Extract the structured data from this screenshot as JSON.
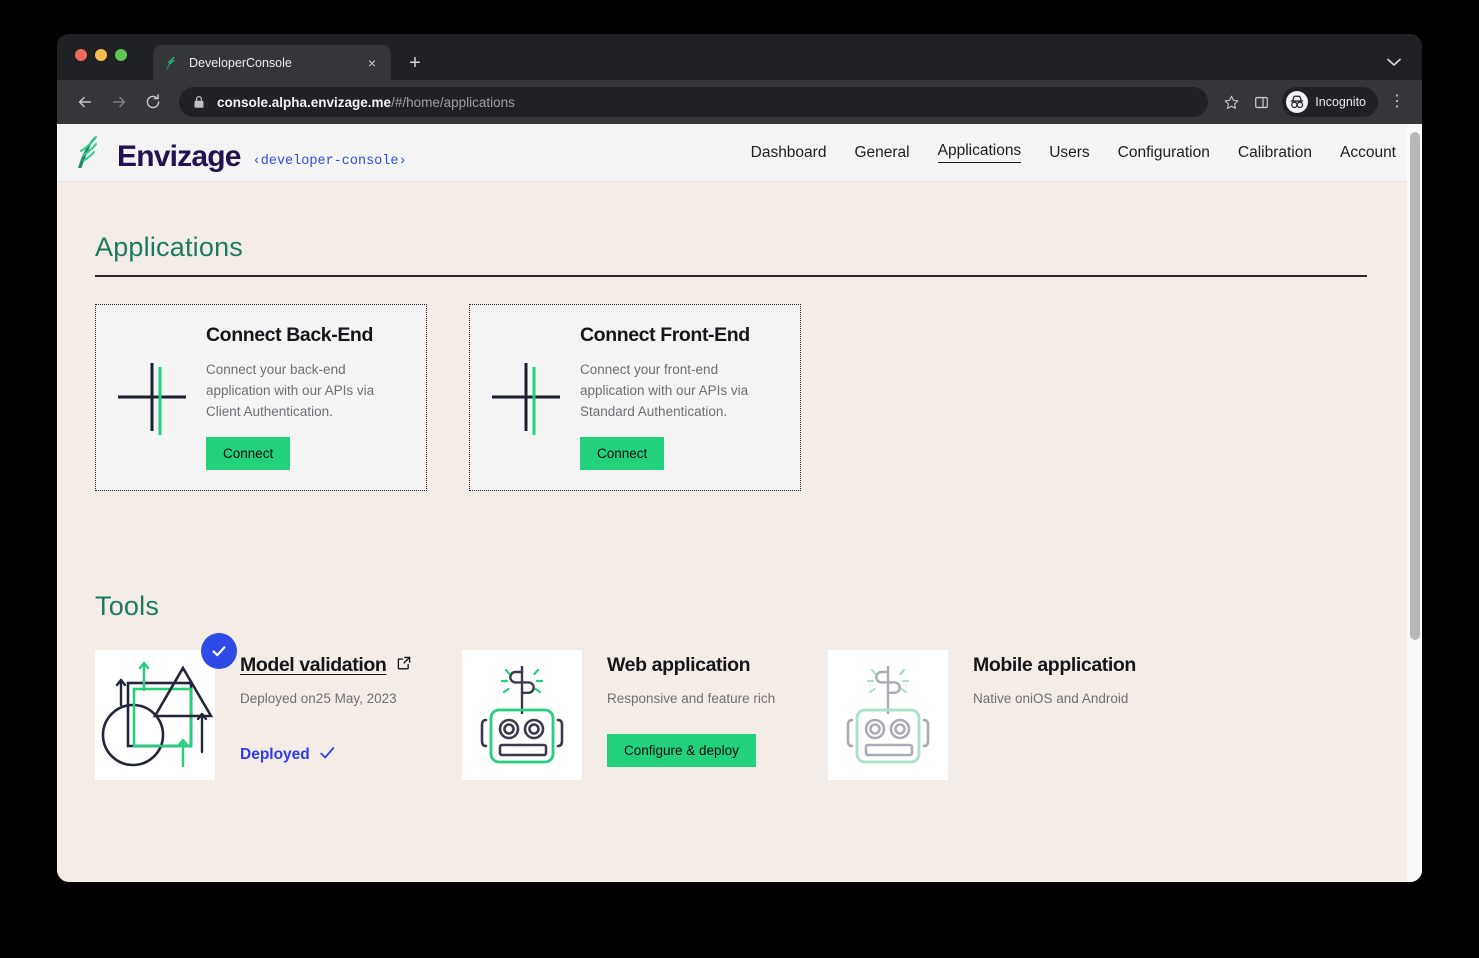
{
  "browser": {
    "tab": {
      "title": "DeveloperConsole",
      "favicon": "envizage-leaf-favicon",
      "close_label": "×"
    },
    "new_tab_label": "+",
    "url": {
      "host": "console.alpha.envizage.me",
      "path": "/#/home/applications"
    },
    "profile": {
      "label": "Incognito"
    },
    "icons": {
      "back": "back-arrow-icon",
      "forward": "forward-arrow-icon",
      "reload": "reload-icon",
      "lock": "lock-icon",
      "bookmark": "star-icon",
      "sidepanel": "side-panel-icon",
      "menu": "kebab-menu-icon",
      "window_chevron": "chevron-down-icon"
    }
  },
  "app": {
    "brand": {
      "name": "Envizage",
      "subtitle": "‹developer-console›"
    },
    "nav": [
      {
        "label": "Dashboard",
        "active": false
      },
      {
        "label": "General",
        "active": false
      },
      {
        "label": "Applications",
        "active": true
      },
      {
        "label": "Users",
        "active": false
      },
      {
        "label": "Configuration",
        "active": false
      },
      {
        "label": "Calibration",
        "active": false
      },
      {
        "label": "Account",
        "active": false
      }
    ]
  },
  "applications": {
    "heading": "Applications",
    "cards": [
      {
        "title": "Connect Back-End",
        "description": "Connect your back-end application with our APIs via Client Authentication.",
        "button": "Connect",
        "icon": "plus-cross-icon"
      },
      {
        "title": "Connect Front-End",
        "description": "Connect your front-end application with our APIs via Standard Authentication.",
        "button": "Connect",
        "icon": "plus-cross-icon"
      }
    ]
  },
  "tools": {
    "heading": "Tools",
    "items": [
      {
        "title": "Model validation",
        "subtitle": "Deployed on25 May, 2023",
        "status": "Deployed",
        "badge": "check-badge",
        "icon": "shapes-arrows-icon",
        "link_icon": "external-link-icon"
      },
      {
        "title": "Web application",
        "subtitle": "Responsive and feature rich",
        "button": "Configure & deploy",
        "icon": "robot-icon"
      },
      {
        "title": "Mobile application",
        "subtitle": "Native oniOS and Android",
        "icon": "robot-icon-disabled"
      }
    ]
  },
  "colors": {
    "accent_green": "#23D07C",
    "heading_teal": "#1A7A62",
    "brand_navy": "#231250",
    "link_blue": "#2E4BE8",
    "page_bg": "#F4EDE7"
  }
}
